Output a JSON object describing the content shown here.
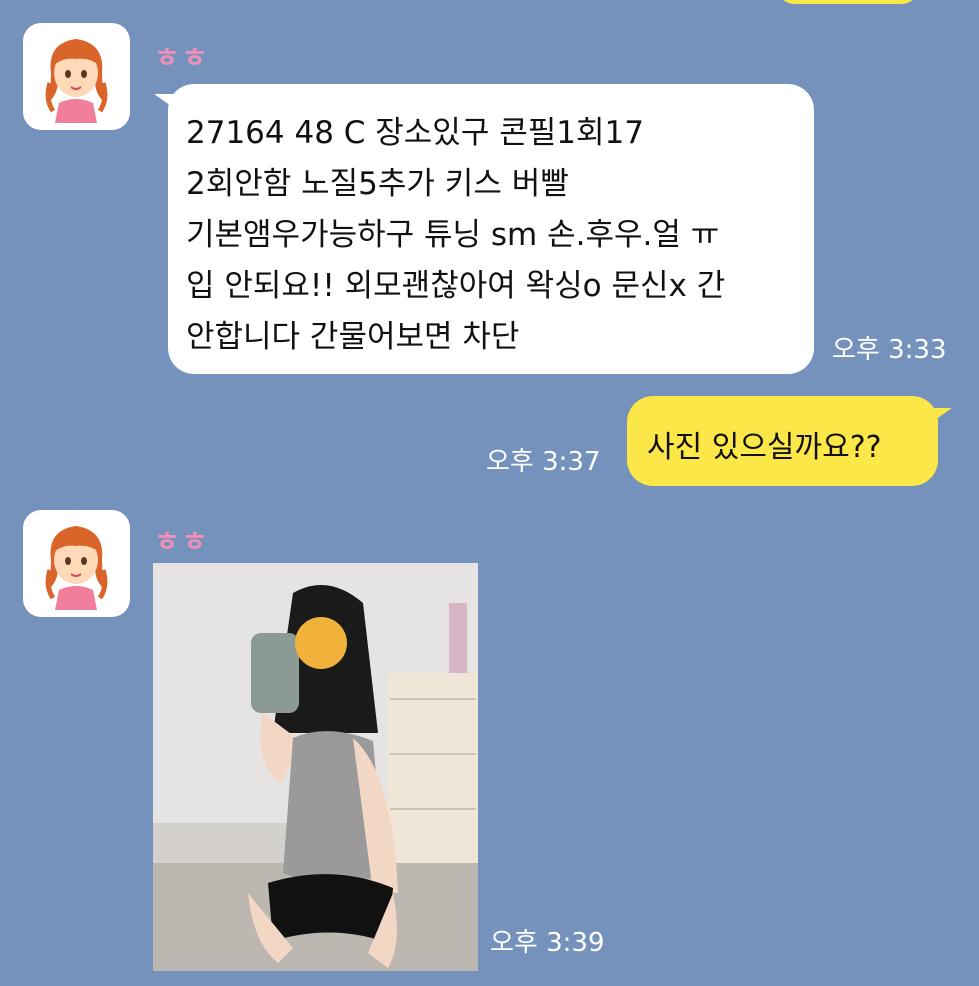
{
  "messages": [
    {
      "sender": "ㅎㅎ",
      "avatar_icon": "girl-avatar-icon",
      "lines": [
        "27164 48 C 장소있구 콘필1회17",
        "2회안함 노질5추가  키스 버빨",
        "기본앰우가능하구  튜닝 sm 손.후우.얼 ㅠ",
        "입 안되요!!  외모괜찮아여 왁싱o 문신x 간",
        "안합니다 간물어보면 차단"
      ],
      "time": "오후 3:33"
    },
    {
      "outgoing": true,
      "text": "사진 있으실까요??",
      "time": "오후 3:37"
    },
    {
      "sender": "ㅎㅎ",
      "avatar_icon": "girl-avatar-icon",
      "attachment": "photo",
      "time": "오후 3:39"
    }
  ],
  "colors": {
    "background": "#7592bd",
    "incoming_bubble": "#ffffff",
    "outgoing_bubble": "#fbe747",
    "sender_name": "#f08fb8",
    "timestamp": "#ffffff"
  }
}
